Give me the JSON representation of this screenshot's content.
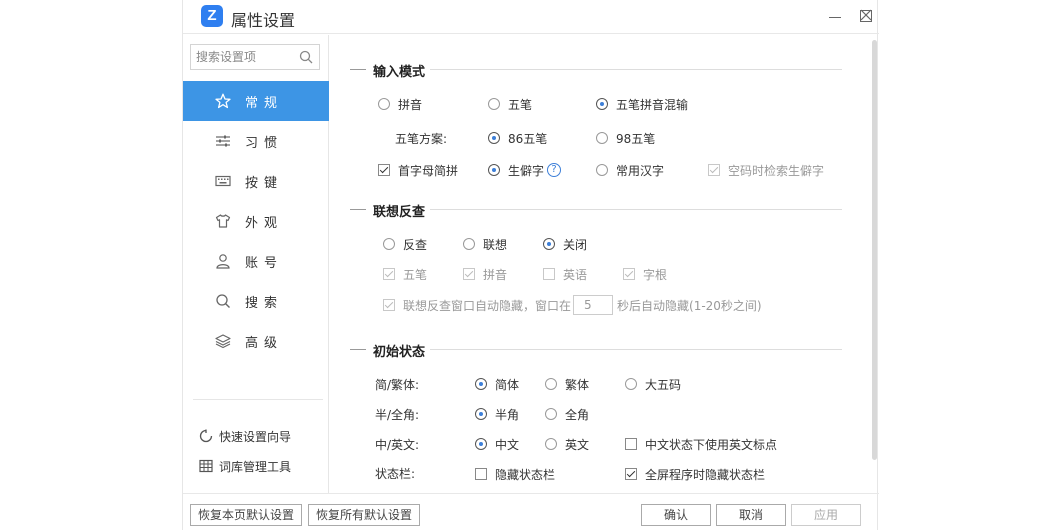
{
  "window": {
    "title": "属性设置",
    "logo_text": "Z"
  },
  "search": {
    "placeholder": "搜索设置项"
  },
  "sidebar": {
    "items": [
      {
        "label": "常规",
        "icon": "star-icon",
        "active": true
      },
      {
        "label": "习惯",
        "icon": "sliders-icon"
      },
      {
        "label": "按键",
        "icon": "keyboard-icon"
      },
      {
        "label": "外观",
        "icon": "tshirt-icon"
      },
      {
        "label": "账号",
        "icon": "user-icon"
      },
      {
        "label": "搜索",
        "icon": "search-icon"
      },
      {
        "label": "高级",
        "icon": "layers-icon"
      }
    ],
    "links": [
      {
        "label": "快速设置向导",
        "icon": "refresh-icon"
      },
      {
        "label": "词库管理工具",
        "icon": "grid-icon"
      }
    ]
  },
  "input_mode": {
    "title": "输入模式",
    "modes": [
      {
        "label": "拼音",
        "checked": false
      },
      {
        "label": "五笔",
        "checked": false
      },
      {
        "label": "五笔拼音混输",
        "checked": true
      }
    ],
    "wubi_scheme_label": "五笔方案:",
    "schemes": [
      {
        "label": "86五笔",
        "checked": true
      },
      {
        "label": "98五笔",
        "checked": false
      }
    ],
    "initials": {
      "label": "首字母简拼",
      "checked": true
    },
    "rare_chars": {
      "label": "生僻字",
      "checked": true
    },
    "common_chars": {
      "label": "常用汉字",
      "checked": false
    },
    "empty_code_search": {
      "label": "空码时检索生僻字",
      "checked": true,
      "disabled": true
    }
  },
  "association": {
    "title": "联想反查",
    "modes": [
      {
        "label": "反查",
        "checked": false
      },
      {
        "label": "联想",
        "checked": false
      },
      {
        "label": "关闭",
        "checked": true
      }
    ],
    "sources": [
      {
        "label": "五笔",
        "checked": true
      },
      {
        "label": "拼音",
        "checked": true
      },
      {
        "label": "英语",
        "checked": false
      },
      {
        "label": "字根",
        "checked": true
      }
    ],
    "auto_hide_label": "联想反查窗口自动隐藏，窗口在",
    "auto_hide_value": "5",
    "auto_hide_suffix": "秒后自动隐藏(1-20秒之间)"
  },
  "initial_state": {
    "title": "初始状态",
    "charset_label": "简/繁体:",
    "charset": [
      {
        "label": "简体",
        "checked": true
      },
      {
        "label": "繁体",
        "checked": false
      },
      {
        "label": "大五码",
        "checked": false
      }
    ],
    "width_label": "半/全角:",
    "width": [
      {
        "label": "半角",
        "checked": true
      },
      {
        "label": "全角",
        "checked": false
      }
    ],
    "lang_label": "中/英文:",
    "lang": [
      {
        "label": "中文",
        "checked": true
      },
      {
        "label": "英文",
        "checked": false
      }
    ],
    "english_punct": {
      "label": "中文状态下使用英文标点",
      "checked": false
    },
    "statusbar_label": "状态栏:",
    "hide_statusbar": {
      "label": "隐藏状态栏",
      "checked": false
    },
    "fullscreen_hide": {
      "label": "全屏程序时隐藏状态栏",
      "checked": true
    }
  },
  "footer": {
    "restore_page": "恢复本页默认设置",
    "restore_all": "恢复所有默认设置",
    "ok": "确认",
    "cancel": "取消",
    "apply": "应用"
  },
  "colors": {
    "accent": "#3d95e5",
    "logo": "#2f7ff0"
  }
}
